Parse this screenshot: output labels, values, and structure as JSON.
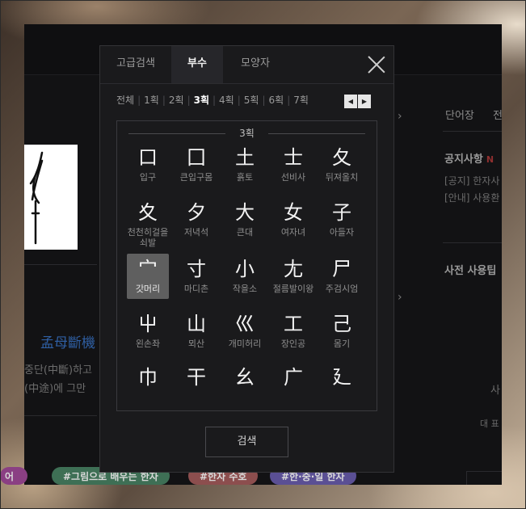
{
  "background_page": {
    "idiom_title": "孟母斷機",
    "meaning_line1": "중단(中斷)하고",
    "meaning_line2": "(中途)에 그만",
    "sidebar_tab_label": "단어장",
    "sidebar_tab_clipped": "전",
    "notice_title": "공지사항",
    "notice_badge": "N",
    "notice_items": [
      "[공지] 한자사",
      "[안내] 사용환"
    ],
    "tips_title": "사전 사용팁",
    "side_text_1": "사",
    "side_text_2": "대 표"
  },
  "tag_pills": [
    {
      "label": "어",
      "color": "#8a3f83"
    },
    {
      "label": "#그림으로 배우는 한자",
      "color": "#3e6f55"
    },
    {
      "label": "#한자 수호",
      "color": "#8c4e4e"
    },
    {
      "label": "#한·중·일 한자",
      "color": "#5a4f94"
    }
  ],
  "modal": {
    "tabs": [
      {
        "label": "고급검색",
        "active": false
      },
      {
        "label": "부수",
        "active": true
      },
      {
        "label": "모양자",
        "active": false
      }
    ],
    "stroke_filters": [
      "전체",
      "1획",
      "2획",
      "3획",
      "4획",
      "5획",
      "6획",
      "7획"
    ],
    "active_stroke": "3획",
    "pager_prev": "◀",
    "pager_next": "▶",
    "group_label": "3획",
    "radicals": [
      {
        "char": "口",
        "name": "입구"
      },
      {
        "char": "囗",
        "name": "큰입구몸"
      },
      {
        "char": "土",
        "name": "흙토"
      },
      {
        "char": "士",
        "name": "선비사"
      },
      {
        "char": "夂",
        "name": "뒤져올치"
      },
      {
        "char": "夊",
        "name": "천천히걸을쇠발"
      },
      {
        "char": "夕",
        "name": "저녁석"
      },
      {
        "char": "大",
        "name": "큰대"
      },
      {
        "char": "女",
        "name": "여자녀"
      },
      {
        "char": "子",
        "name": "아들자"
      },
      {
        "char": "宀",
        "name": "갓머리",
        "selected": true
      },
      {
        "char": "寸",
        "name": "마디촌"
      },
      {
        "char": "小",
        "name": "작을소"
      },
      {
        "char": "尢",
        "name": "절름발이왕"
      },
      {
        "char": "尸",
        "name": "주검시엄"
      },
      {
        "char": "屮",
        "name": "왼손좌"
      },
      {
        "char": "山",
        "name": "뫼산"
      },
      {
        "char": "巛",
        "name": "개미허리"
      },
      {
        "char": "工",
        "name": "장인공"
      },
      {
        "char": "己",
        "name": "몸기"
      },
      {
        "char": "巾",
        "name": ""
      },
      {
        "char": "干",
        "name": ""
      },
      {
        "char": "幺",
        "name": ""
      },
      {
        "char": "广",
        "name": ""
      },
      {
        "char": "廴",
        "name": ""
      }
    ],
    "search_label": "검색"
  }
}
